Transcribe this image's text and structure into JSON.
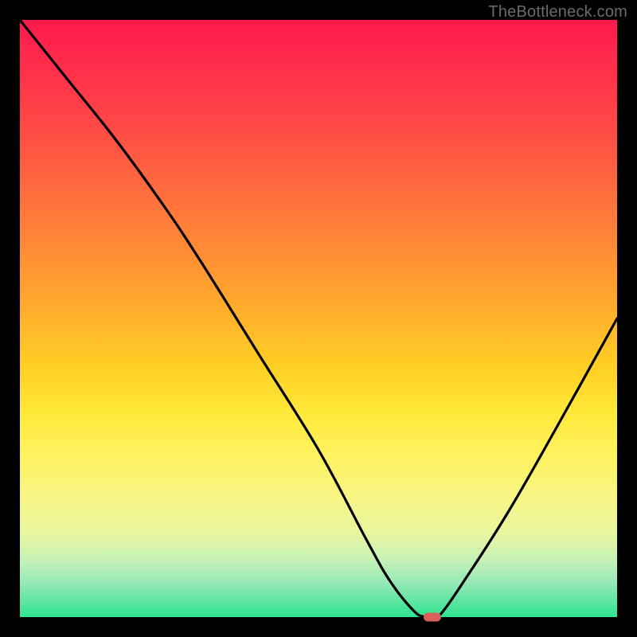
{
  "watermark": "TheBottleneck.com",
  "colors": {
    "background": "#000000",
    "curve": "#000000",
    "marker": "#d9605b",
    "gradient_top": "#ff1a4d",
    "gradient_bottom": "#2ee38f"
  },
  "chart_data": {
    "type": "line",
    "title": "",
    "xlabel": "",
    "ylabel": "",
    "xlim": [
      0,
      100
    ],
    "ylim": [
      0,
      100
    ],
    "series": [
      {
        "name": "bottleneck-curve",
        "x": [
          0,
          8,
          16,
          24,
          30,
          40,
          50,
          58,
          62,
          66,
          68,
          70,
          75,
          82,
          90,
          100
        ],
        "values": [
          100,
          90,
          80,
          69,
          60,
          44,
          28,
          13,
          6,
          1,
          0,
          0,
          7,
          18,
          32,
          50
        ]
      }
    ],
    "marker": {
      "x": 69,
      "y": 0
    },
    "annotations": [
      {
        "text": "TheBottleneck.com",
        "role": "watermark",
        "pos": "top-right"
      }
    ]
  }
}
